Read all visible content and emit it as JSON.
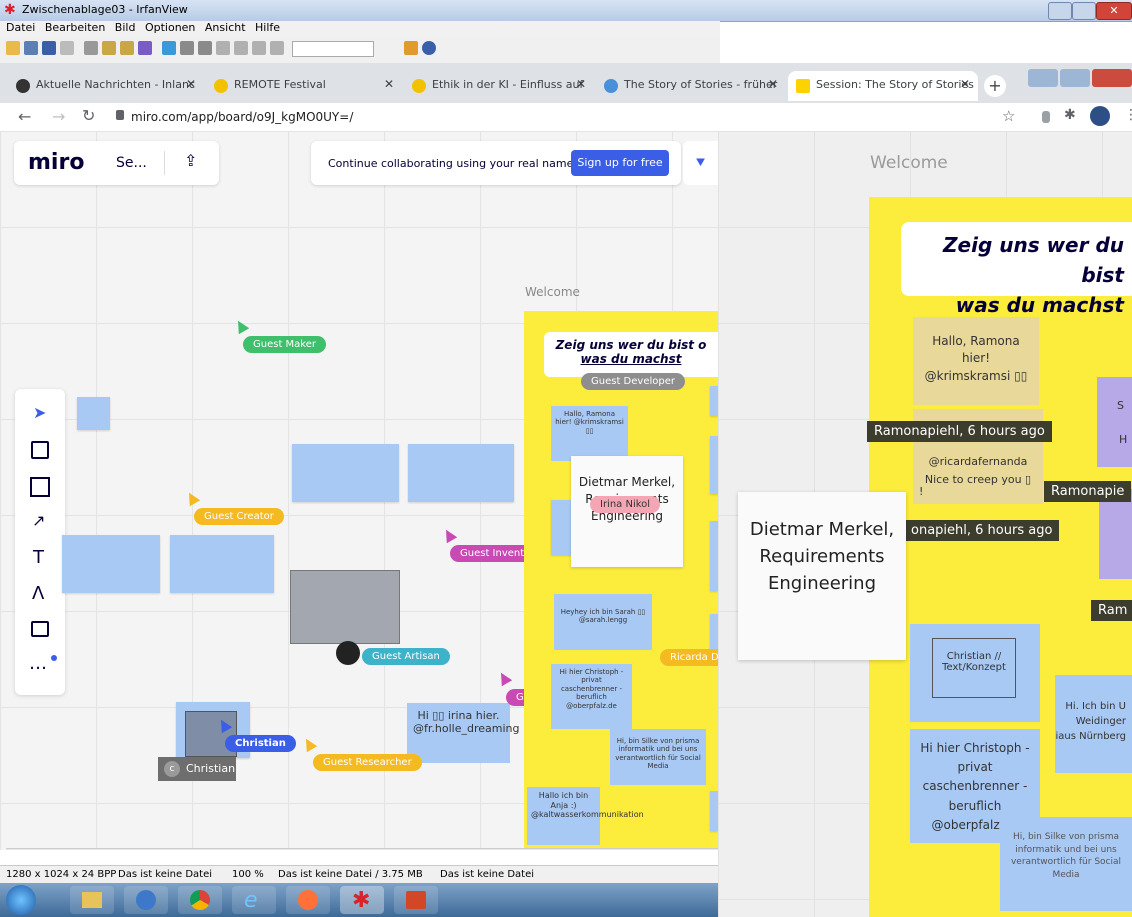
{
  "window": {
    "title": "Zwischenablage03 - IrfanView",
    "menu": [
      "Datei",
      "Bearbeiten",
      "Bild",
      "Optionen",
      "Ansicht",
      "Hilfe"
    ]
  },
  "browser": {
    "tabs": [
      {
        "label": "Aktuelle Nachrichten - Inlanc",
        "active": false
      },
      {
        "label": "REMOTE Festival",
        "active": false
      },
      {
        "label": "Ethik in der KI - Einfluss auf",
        "active": false
      },
      {
        "label": "The Story of Stories - früher",
        "active": false
      },
      {
        "label": "Session: The Story of Stories",
        "active": true
      }
    ],
    "url": "miro.com/app/board/o9J_kgMO0UY=/"
  },
  "miro": {
    "logo": "miro",
    "board_short": "Se...",
    "banner_text": "Continue collaborating using your real name.",
    "signup_label": "Sign up for free",
    "frame_label": "Welcome",
    "frame_title_line1": "Zeig uns wer du bist o",
    "frame_title_line2": "was du machst",
    "cursors": [
      {
        "label": "Guest Maker",
        "color": "#3fbf6b"
      },
      {
        "label": "Guest Developer",
        "color": "#8e8e8e"
      },
      {
        "label": "Guest Creator",
        "color": "#f5b922"
      },
      {
        "label": "Guest Inventor",
        "color": "#c94ab5"
      },
      {
        "label": "Guest Artisan",
        "color": "#3db3c9"
      },
      {
        "label": "Ricarda D",
        "color": "#f5b922"
      },
      {
        "label": "Guest Creator",
        "color": "#c94ab5"
      },
      {
        "label": "Christian",
        "color": "#3b5ee6"
      },
      {
        "label": "Guest Researcher",
        "color": "#f5b922"
      },
      {
        "label": "Irina Nikol",
        "color": "#f5a6b4"
      }
    ],
    "avatar_label": "Christian",
    "avatar_initial": "c",
    "notes": {
      "ramona": "Hallo, Ramona hier! @krimskramsi ▯▯",
      "dietmar": "Dietmar Merkel, Requirements Engineering",
      "sarah": "Heyhey ich bin Sarah ▯▯ @sarah.lengg",
      "christoph": "Hi hier Christoph - privat caschenbrenner - beruflich @oberpfalz.de",
      "irina": "Hi ▯▯ irina hier. @fr.holle_dreaming",
      "silke": "Hi, bin Silke von prisma informatik und bei uns verantwortlich für Social Media",
      "anja": "Hallo ich bin Anja :) @kaltwasserkommunikation"
    }
  },
  "zoom": {
    "frame_label": "Welcome",
    "title_line1": "Zeig uns wer du bist",
    "title_line2": "was du machst",
    "ramona_note": "Hallo, Ramona hier! @krimskramsi ▯▯",
    "ramona_tag": "Ramonapiehl, 6 hours ago",
    "ricarda_line1": "@ricardafernanda",
    "ricarda_line2": "Nice to creep you ▯",
    "ricarda_line3": "!",
    "ramona_tag2": "Ramonapie",
    "ramona_tag3": "onapiehl, 6 hours ago",
    "ram_tag4": "Ram",
    "dietmar": "Dietmar Merkel, Requirements Engineering",
    "christian_note": "Christian // Text/Konzept",
    "christoph": "Hi hier Christoph - privat caschenbrenner - beruflich @oberpfalz.de",
    "weidinger": "Hi. Ich bin U Weidinger iaus Nürnberg",
    "silke": "Hi, bin Silke von prisma informatik und bei uns verantwortlich für Social Media",
    "side_letters": [
      "S",
      "H"
    ]
  },
  "status": {
    "dims": "1280 x 1024 x 24 BPP",
    "file": "Das ist keine Datei",
    "zoom": "100 %",
    "size": "Das ist keine Datei / 3.75 MB",
    "file2": "Das ist keine Datei"
  },
  "colors": {
    "miro_yellow": "#fcec3c",
    "sticky_blue": "#a9c9f5",
    "signup_blue": "#3b5ee6"
  }
}
